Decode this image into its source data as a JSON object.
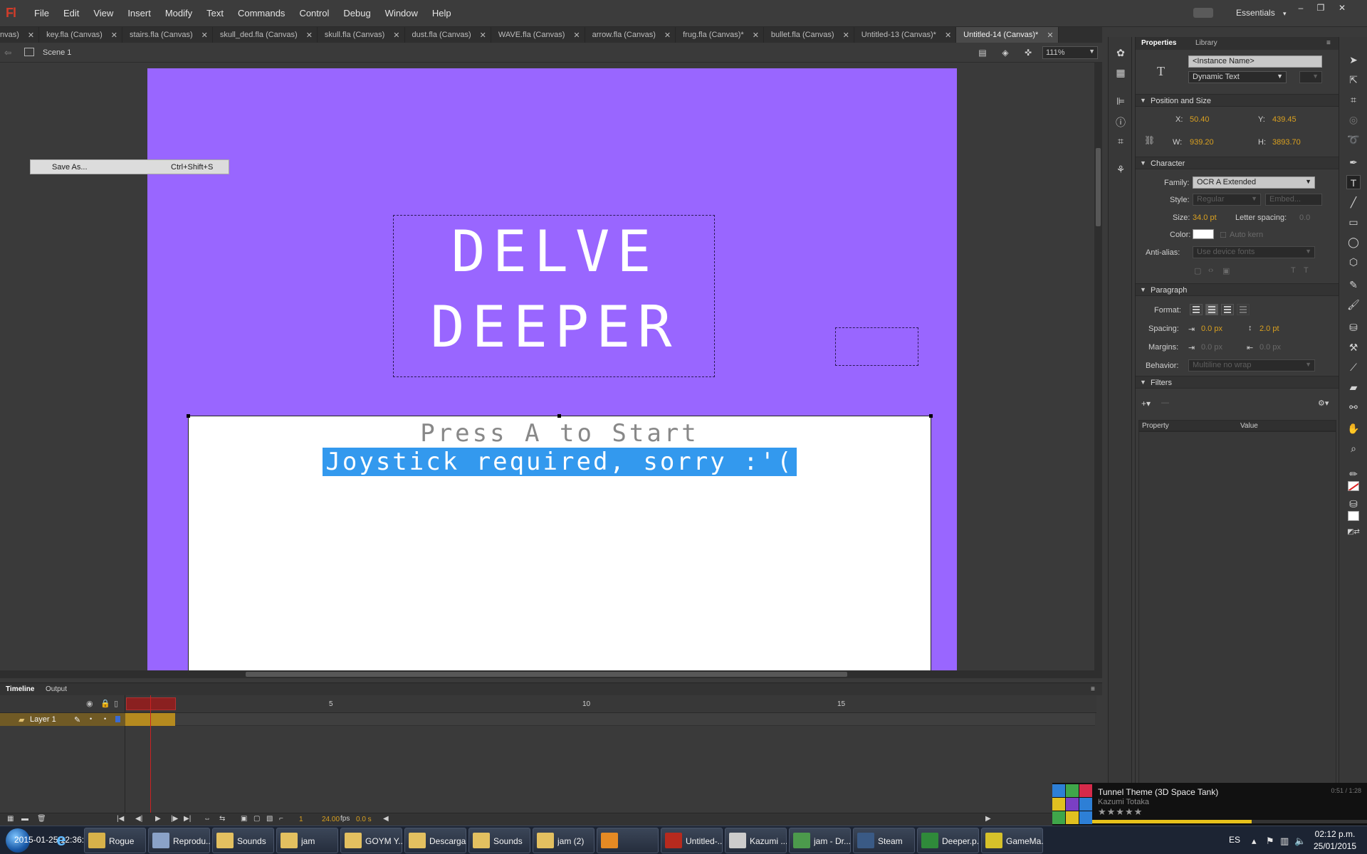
{
  "app": {
    "logo": "Fl"
  },
  "menu": [
    "File",
    "Edit",
    "View",
    "Insert",
    "Modify",
    "Text",
    "Commands",
    "Control",
    "Debug",
    "Window",
    "Help"
  ],
  "workspace": {
    "label": "Essentials",
    "arrow": "▾"
  },
  "window_controls": [
    "‒",
    "❐",
    "✕"
  ],
  "doc_tabs": [
    {
      "label": "nvas)",
      "active": false
    },
    {
      "label": "key.fla (Canvas)",
      "active": false
    },
    {
      "label": "stairs.fla (Canvas)",
      "active": false
    },
    {
      "label": "skull_ded.fla (Canvas)",
      "active": false
    },
    {
      "label": "skull.fla (Canvas)",
      "active": false
    },
    {
      "label": "dust.fla (Canvas)",
      "active": false
    },
    {
      "label": "WAVE.fla (Canvas)",
      "active": false
    },
    {
      "label": "arrow.fla (Canvas)",
      "active": false
    },
    {
      "label": "frug.fla (Canvas)*",
      "active": false
    },
    {
      "label": "bullet.fla (Canvas)",
      "active": false
    },
    {
      "label": "Untitled-13 (Canvas)*",
      "active": false
    },
    {
      "label": "Untitled-14 (Canvas)*",
      "active": true
    }
  ],
  "editbar": {
    "scene": "Scene 1",
    "zoom": "111%"
  },
  "context_menu": {
    "label": "Save As...",
    "shortcut": "Ctrl+Shift+S"
  },
  "stage": {
    "title_line1": "DELVE",
    "title_line2": "DEEPER",
    "press_text": "Press A to Start",
    "selected_text": "Joystick required, sorry :'(",
    "bg_color": "#9966ff"
  },
  "timeline": {
    "tabs": [
      "Timeline",
      "Output"
    ],
    "layer_name": "Layer 1",
    "frame_labels": [
      "1",
      "5",
      "10",
      "15"
    ],
    "current_frame": "1",
    "fps": "24.00",
    "fps_unit": "fps",
    "elapsed": "0.0 s"
  },
  "properties": {
    "tabs": [
      "Properties",
      "Library"
    ],
    "instance_name_placeholder": "<Instance Name>",
    "text_type": "Dynamic Text",
    "position_section": "Position and Size",
    "x_label": "X:",
    "x_value": "50.40",
    "y_label": "Y:",
    "y_value": "439.45",
    "w_label": "W:",
    "w_value": "939.20",
    "h_label": "H:",
    "h_value": "3893.70",
    "character_section": "Character",
    "family_label": "Family:",
    "family_value": "OCR A Extended",
    "style_label": "Style:",
    "style_value": "Regular",
    "embed_label": "Embed...",
    "size_label": "Size:",
    "size_value": "34.0 pt",
    "letter_spacing_label": "Letter spacing:",
    "letter_spacing_value": "0.0",
    "color_label": "Color:",
    "auto_kern_label": "Auto kern",
    "antialias_label": "Anti-alias:",
    "antialias_value": "Use device fonts",
    "paragraph_section": "Paragraph",
    "format_label": "Format:",
    "spacing_label": "Spacing:",
    "spacing_indent": "0.0 px",
    "spacing_line": "2.0 pt",
    "margins_label": "Margins:",
    "margin_left": "0.0 px",
    "margin_right": "0.0 px",
    "behavior_label": "Behavior:",
    "behavior_value": "Multiline no wrap",
    "filters_section": "Filters",
    "filters_col_property": "Property",
    "filters_col_value": "Value",
    "text_color": "#ffffff"
  },
  "music": {
    "track": "Tunnel Theme (3D Space Tank)",
    "artist": "Kazumi Totaka",
    "time": "0:51 / 1:28",
    "stars": "★★★★★",
    "progress": 0.58
  },
  "taskbar": {
    "clock_overlay": "2015-01-25 12:36:56",
    "items": [
      {
        "label": "Rogue",
        "color": "#d8b24a"
      },
      {
        "label": "Reprodu...",
        "color": "#8aa2c8"
      },
      {
        "label": "Sounds",
        "color": "#e3c060"
      },
      {
        "label": "jam",
        "color": "#e3c060"
      },
      {
        "label": "GOYM Y...",
        "color": "#e3c060"
      },
      {
        "label": "Descargas",
        "color": "#e3c060"
      },
      {
        "label": "Sounds",
        "color": "#e3c060"
      },
      {
        "label": "jam (2)",
        "color": "#e3c060"
      },
      {
        "label": "",
        "color": "#e58a24"
      },
      {
        "label": "Untitled-...",
        "color": "#b72a1e"
      },
      {
        "label": "Kazumi ...",
        "color": "#cccccc"
      },
      {
        "label": "jam - Dr...",
        "color": "#4c9a4c"
      },
      {
        "label": "Steam",
        "color": "#3a5a85"
      },
      {
        "label": "Deeper.p...",
        "color": "#2f8a3a"
      },
      {
        "label": "GameMa...",
        "color": "#d6c12a"
      }
    ],
    "lang": "ES",
    "time": "02:12 p.m.",
    "date": "25/01/2015"
  }
}
